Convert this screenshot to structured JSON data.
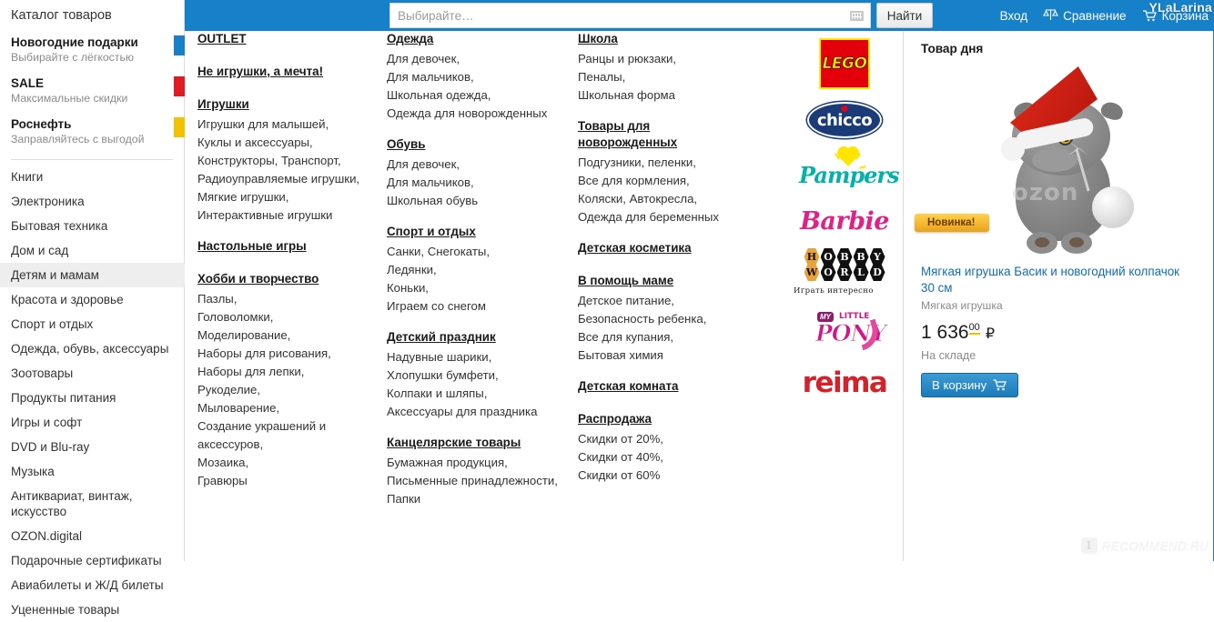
{
  "header": {
    "search": {
      "placeholder": "Выбирайте…",
      "value": "",
      "keyboard_icon": "keyboard-icon"
    },
    "find_button": "Найти",
    "links": [
      {
        "label": "Вход",
        "icon": ""
      },
      {
        "label": "Сравнение",
        "icon": "compare-icon"
      },
      {
        "label": "Корзина",
        "icon": "cart-icon"
      }
    ],
    "watermark_user": "YLaLarina",
    "accent_blue": "#1681c8"
  },
  "sidebar": {
    "title": "Каталог товаров",
    "promos": [
      {
        "title": "Новогодние подарки",
        "subtitle": "Выбирайте с лёгкостью",
        "flag_color": "#1681c8"
      },
      {
        "title": "SALE",
        "subtitle": "Максимальные скидки",
        "flag_color": "#e01b24"
      },
      {
        "title": "Роснефть",
        "subtitle": "Заправляйтесь с выгодой",
        "flag_color": "#f2c200"
      }
    ],
    "items": [
      {
        "label": "Книги",
        "active": false
      },
      {
        "label": "Электроника",
        "active": false
      },
      {
        "label": "Бытовая техника",
        "active": false
      },
      {
        "label": "Дом и сад",
        "active": false
      },
      {
        "label": "Детям и мамам",
        "active": true
      },
      {
        "label": "Красота и здоровье",
        "active": false
      },
      {
        "label": "Спорт и отдых",
        "active": false
      },
      {
        "label": "Одежда, обувь, аксессуары",
        "active": false
      },
      {
        "label": "Зоотовары",
        "active": false
      },
      {
        "label": "Продукты питания",
        "active": false
      },
      {
        "label": "Игры и софт",
        "active": false
      },
      {
        "label": "DVD и Blu-ray",
        "active": false
      },
      {
        "label": "Музыка",
        "active": false
      },
      {
        "label": "Антиквариат, винтаж, искусство",
        "active": false
      },
      {
        "label": "OZON.digital",
        "active": false
      },
      {
        "label": "Подарочные сертификаты",
        "active": false
      },
      {
        "label": "Авиабилеты и Ж/Д билеты",
        "active": false
      },
      {
        "label": "Уцененные товары",
        "active": false
      }
    ]
  },
  "mega_menu": {
    "column1": [
      {
        "heading": "OUTLET",
        "items": []
      },
      {
        "heading": "Не игрушки, а мечта!",
        "items": []
      },
      {
        "heading": "Игрушки",
        "items": [
          "Игрушки для малышей,",
          "Куклы и аксессуары,",
          "Конструкторы, Транспорт,",
          "Радиоуправляемые игрушки,",
          "Мягкие игрушки,",
          "Интерактивные игрушки"
        ]
      },
      {
        "heading": "Настольные игры",
        "items": []
      },
      {
        "heading": "Хобби и творчество",
        "items": [
          "Пазлы,",
          "Головоломки,",
          "Моделирование,",
          "Наборы для рисования,",
          "Наборы для лепки,",
          "Рукоделие,",
          "Мыловарение,",
          "Создание украшений и аксессуров,",
          "Мозаика,",
          "Гравюры"
        ]
      }
    ],
    "column2": [
      {
        "heading": "Одежда",
        "items": [
          "Для девочек,",
          "Для мальчиков,",
          "Школьная одежда,",
          "Одежда для новорожденных"
        ]
      },
      {
        "heading": "Обувь",
        "items": [
          "Для девочек,",
          "Для мальчиков,",
          "Школьная обувь"
        ]
      },
      {
        "heading": "Спорт и отдых",
        "items": [
          "Санки, Снегокаты,",
          "Ледянки,",
          "Коньки,",
          "Играем со снегом"
        ]
      },
      {
        "heading": "Детский праздник",
        "items": [
          "Надувные шарики,",
          "Хлопушки бумфети,",
          "Колпаки и шляпы,",
          "Аксессуары для праздника"
        ]
      },
      {
        "heading": "Канцелярские товары",
        "items": [
          "Бумажная продукция,",
          "Письменные принадлежности,",
          "Папки"
        ]
      }
    ],
    "column3": [
      {
        "heading": "Школа",
        "items": [
          "Ранцы и рюкзаки,",
          "Пеналы,",
          "Школьная форма"
        ]
      },
      {
        "heading": "Товары для новорожденных",
        "items": [
          "Подгузники, пеленки,",
          "Все для кормления,",
          "Коляски, Автокресла,",
          "Одежда для беременных"
        ]
      },
      {
        "heading": "Детская косметика",
        "items": []
      },
      {
        "heading": "В помощь маме",
        "items": [
          "Детское питание,",
          "Безопасность ребенка,",
          "Все для купания,",
          "Бытовая химия"
        ]
      },
      {
        "heading": "Детская комната",
        "items": []
      },
      {
        "heading": "Распродажа",
        "items": [
          "Скидки от 20%,",
          "Скидки от 40%,",
          "Скидки от 60%"
        ]
      }
    ],
    "brands": [
      {
        "name": "LEGO",
        "icon": "lego-logo"
      },
      {
        "name": "chicco",
        "icon": "chicco-logo"
      },
      {
        "name": "Pampers",
        "icon": "pampers-logo"
      },
      {
        "name": "Barbie",
        "icon": "barbie-logo"
      },
      {
        "name": "HOBBY WORLD",
        "tagline": "Играть интересно",
        "icon": "hobby-world-logo"
      },
      {
        "name": "MY LITTLE PONY",
        "icon": "my-little-pony-logo"
      },
      {
        "name": "reima",
        "icon": "reima-logo"
      }
    ]
  },
  "product_of_day": {
    "title": "Товар дня",
    "badge": "Новинка!",
    "name": "Мягкая игрушка Басик и новогодний колпачок 30 см",
    "category": "Мягкая игрушка",
    "price_main": "1 636",
    "price_kop": "00",
    "currency": "₽",
    "stock": "На складе",
    "cart_button": "В корзину",
    "image_watermark": "ozon"
  },
  "watermark": {
    "badge": "I",
    "text": "RECOMMEND.RU"
  }
}
